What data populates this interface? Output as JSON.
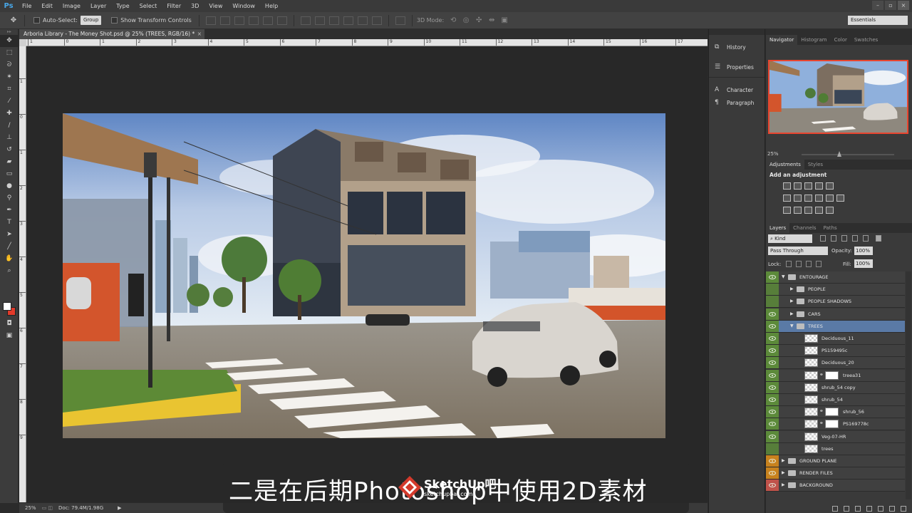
{
  "app": {
    "logo": "Ps"
  },
  "menu": [
    "File",
    "Edit",
    "Image",
    "Layer",
    "Type",
    "Select",
    "Filter",
    "3D",
    "View",
    "Window",
    "Help"
  ],
  "options_bar": {
    "auto_select_label": "Auto-Select:",
    "auto_select_value": "Group",
    "show_transform_label": "Show Transform Controls",
    "mode_3d_label": "3D Mode:",
    "workspace": "Essentials"
  },
  "document": {
    "tab_title": "Arboria Library - The Money Shot.psd @ 25% (TREES, RGB/16) *",
    "close_glyph": "×"
  },
  "rulers": {
    "top": [
      "1",
      "0",
      "1",
      "2",
      "3",
      "4",
      "5",
      "6",
      "7",
      "8",
      "9",
      "10",
      "11",
      "12",
      "13",
      "14",
      "15",
      "16",
      "17"
    ],
    "left": [
      "1",
      "0",
      "1",
      "2",
      "3",
      "4",
      "5",
      "6",
      "7",
      "8",
      "9"
    ]
  },
  "status": {
    "zoom": "25%",
    "doc": "Doc: 79.4M/1.98G"
  },
  "subtitle": {
    "text": "二是在后期Photoshop中使用2D素材",
    "watermark_brand": "SketchUp吧",
    "watermark_url": "sketchupbar.com"
  },
  "mini_panel": {
    "group1": [
      {
        "icon": "history-icon",
        "label": "History"
      },
      {
        "icon": "properties-icon",
        "label": "Properties"
      }
    ],
    "group2": [
      {
        "icon": "character-icon",
        "label": "Character"
      },
      {
        "icon": "paragraph-icon",
        "label": "Paragraph"
      }
    ]
  },
  "navigator_panel": {
    "tabs": [
      "Navigator",
      "Histogram",
      "Color",
      "Swatches"
    ],
    "zoom": "25%"
  },
  "adjustments_panel": {
    "tabs": [
      "Adjustments",
      "Styles"
    ],
    "title": "Add an adjustment"
  },
  "layers_panel": {
    "tabs": [
      "Layers",
      "Channels",
      "Paths"
    ],
    "filter": "Kind",
    "blend_mode": "Pass Through",
    "opacity_label": "Opacity:",
    "opacity": "100%",
    "lock_label": "Lock:",
    "fill_label": "Fill:",
    "fill": "100%",
    "layers": [
      {
        "name": "ENTOURAGE",
        "type": "group",
        "indent": 0,
        "expanded": true,
        "eye": "green"
      },
      {
        "name": "PEOPLE",
        "type": "group",
        "indent": 1,
        "expanded": false,
        "eye": "none"
      },
      {
        "name": "PEOPLE SHADOWS",
        "type": "group",
        "indent": 1,
        "expanded": false,
        "eye": "none"
      },
      {
        "name": "CARS",
        "type": "group",
        "indent": 1,
        "expanded": false,
        "eye": "green"
      },
      {
        "name": "TREES",
        "type": "group",
        "indent": 1,
        "expanded": true,
        "eye": "green",
        "selected": true
      },
      {
        "name": "Deciduous_11",
        "type": "layer",
        "indent": 2,
        "eye": "green"
      },
      {
        "name": "PS159495c",
        "type": "layer",
        "indent": 2,
        "eye": "green"
      },
      {
        "name": "Deciduous_20",
        "type": "layer",
        "indent": 2,
        "eye": "green"
      },
      {
        "name": "treea31",
        "type": "layer-mask",
        "indent": 2,
        "eye": "green"
      },
      {
        "name": "shrub_54 copy",
        "type": "layer",
        "indent": 2,
        "eye": "green"
      },
      {
        "name": "shrub_54",
        "type": "layer",
        "indent": 2,
        "eye": "green"
      },
      {
        "name": "shrub_56",
        "type": "layer-mask",
        "indent": 2,
        "eye": "green"
      },
      {
        "name": "PS169778c",
        "type": "layer-mask",
        "indent": 2,
        "eye": "green"
      },
      {
        "name": "Veg-07-HR",
        "type": "layer",
        "indent": 2,
        "eye": "green"
      },
      {
        "name": "trees",
        "type": "layer",
        "indent": 2,
        "eye": "none"
      },
      {
        "name": "GROUND PLANE",
        "type": "group",
        "indent": 0,
        "expanded": false,
        "eye": "orange"
      },
      {
        "name": "RENDER FILES",
        "type": "group",
        "indent": 0,
        "expanded": false,
        "eye": "orange"
      },
      {
        "name": "BACKGROUND",
        "type": "group",
        "indent": 0,
        "expanded": false,
        "eye": "red"
      }
    ]
  },
  "colors": {
    "foreground": "#ffffff",
    "background": "#e23a2a",
    "selection": "#5a7aa6",
    "eye_green": "#5c8a3a",
    "eye_orange": "#c8821e",
    "eye_red": "#c0524a"
  }
}
